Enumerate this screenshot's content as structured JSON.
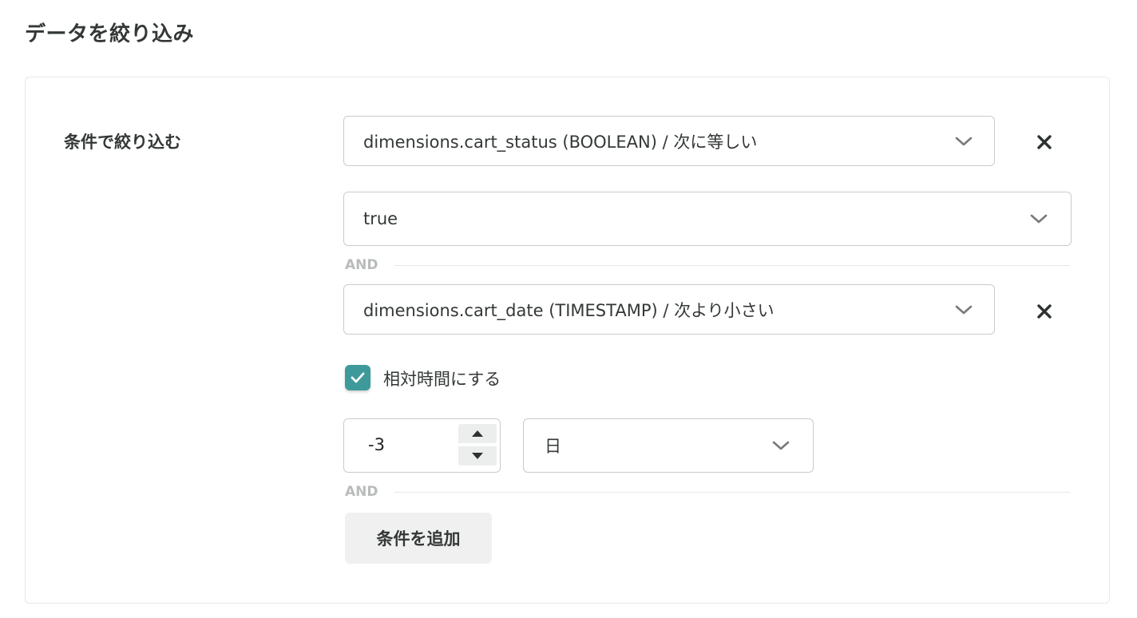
{
  "page": {
    "title": "データを絞り込み"
  },
  "filter": {
    "section_label": "条件で絞り込む",
    "conditions": [
      {
        "field_label": "dimensions.cart_status (BOOLEAN) / 次に等しい",
        "value": "true"
      },
      {
        "field_label": "dimensions.cart_date (TIMESTAMP) / 次より小さい",
        "relative_label": "相対時間にする",
        "relative_checked": true,
        "amount": "-3",
        "unit": "日"
      }
    ],
    "and_label": "AND",
    "add_button_label": "条件を追加"
  },
  "colors": {
    "accent": "#3e9a9a",
    "text": "#333836",
    "border": "#c9cccb",
    "muted": "#b8bcbb"
  },
  "icons": {
    "chevron": "chevron-down-icon",
    "remove": "close-icon",
    "check": "check-icon",
    "stepper_up": "caret-up-icon",
    "stepper_down": "caret-down-icon"
  }
}
